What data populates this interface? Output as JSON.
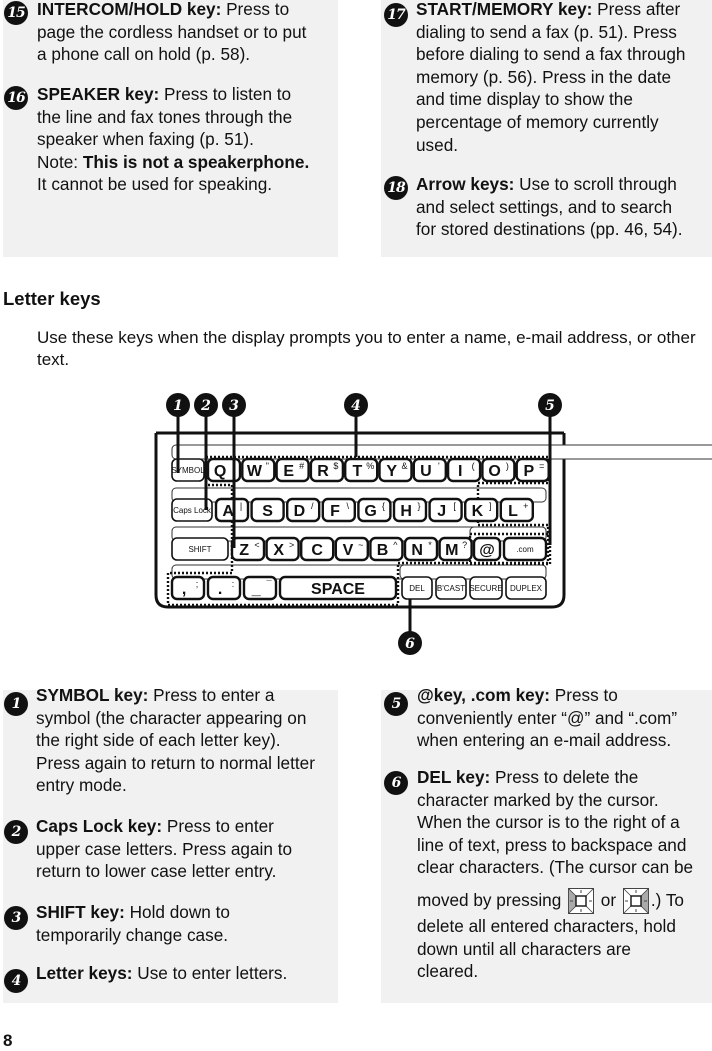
{
  "page_number": "8",
  "top_left": [
    {
      "num": "15",
      "title": "INTERCOM/HOLD key:",
      "lines": [
        " Press to",
        "page the cordless handset or to put",
        "a phone call on hold (p. 58)."
      ]
    },
    {
      "num": "16",
      "title": "SPEAKER key:",
      "lines": [
        " Press to listen to",
        "the line and fax tones through the",
        "speaker when faxing (p. 51)."
      ],
      "note_label": "Note: ",
      "note_bold": "This is not a speakerphone.",
      "note_rest": "It cannot be used for speaking."
    }
  ],
  "top_right": [
    {
      "num": "17",
      "title": "START/MEMORY key:",
      "lines": [
        " Press after",
        "dialing to send a fax (p. 51). Press",
        "before dialing to send a fax through",
        "memory (p. 56). Press in the date",
        "and time display to show the",
        "percentage of memory currently",
        "used."
      ]
    },
    {
      "num": "18",
      "title": "Arrow keys:",
      "lines": [
        " Use to scroll through",
        "and select settings, and to search",
        "for stored destinations (pp. 46, 54)."
      ]
    }
  ],
  "section": {
    "heading": "Letter keys",
    "intro": "Use these keys when the display prompts you to enter a name, e-mail address, or other text."
  },
  "keyboard": {
    "callouts": [
      "1",
      "2",
      "3",
      "4",
      "5",
      "6"
    ],
    "row1": [
      {
        "label": "SYMBOL",
        "alt": ""
      },
      {
        "label": "Q",
        "alt": "!"
      },
      {
        "label": "W",
        "alt": "\""
      },
      {
        "label": "E",
        "alt": "#"
      },
      {
        "label": "R",
        "alt": "$"
      },
      {
        "label": "T",
        "alt": "%"
      },
      {
        "label": "Y",
        "alt": "&"
      },
      {
        "label": "U",
        "alt": "'"
      },
      {
        "label": "I",
        "alt": "("
      },
      {
        "label": "O",
        "alt": ")"
      },
      {
        "label": "P",
        "alt": "="
      }
    ],
    "row2": [
      {
        "label": "Caps Lock",
        "alt": ""
      },
      {
        "label": "A",
        "alt": "|"
      },
      {
        "label": "S",
        "alt": ""
      },
      {
        "label": "D",
        "alt": "/"
      },
      {
        "label": "F",
        "alt": "\\"
      },
      {
        "label": "G",
        "alt": "{"
      },
      {
        "label": "H",
        "alt": "}"
      },
      {
        "label": "J",
        "alt": "["
      },
      {
        "label": "K",
        "alt": "]"
      },
      {
        "label": "L",
        "alt": "+"
      }
    ],
    "row3": [
      {
        "label": "SHIFT",
        "alt": ""
      },
      {
        "label": "Z",
        "alt": "<"
      },
      {
        "label": "X",
        "alt": ">"
      },
      {
        "label": "C",
        "alt": ""
      },
      {
        "label": "V",
        "alt": "~"
      },
      {
        "label": "B",
        "alt": "^"
      },
      {
        "label": "N",
        "alt": "*"
      },
      {
        "label": "M",
        "alt": "?"
      },
      {
        "label": "@",
        "alt": ""
      },
      {
        "label": ".com",
        "alt": ""
      }
    ],
    "row4": [
      {
        "label": ",",
        "alt": ";"
      },
      {
        "label": ".",
        "alt": ":"
      },
      {
        "label": "_",
        "alt": "¯"
      },
      {
        "label": "SPACE",
        "alt": ""
      },
      {
        "label": "DEL",
        "alt": ""
      },
      {
        "label": "B'CAST",
        "alt": ""
      },
      {
        "label": "SECURE",
        "alt": ""
      },
      {
        "label": "DUPLEX",
        "alt": ""
      }
    ]
  },
  "bottom_left": [
    {
      "num": "1",
      "title": "SYMBOL key:",
      "lines": [
        " Press to enter a",
        "symbol (the character appearing on",
        "the right side of each letter key).",
        "Press again to return to normal letter",
        "entry mode."
      ]
    },
    {
      "num": "2",
      "title": "Caps Lock key:",
      "lines": [
        " Press to enter",
        "upper case letters. Press again to",
        "return to lower case letter entry."
      ]
    },
    {
      "num": "3",
      "title": "SHIFT key:",
      "lines": [
        " Hold down to",
        "temporarily change case."
      ]
    },
    {
      "num": "4",
      "title": "Letter keys:",
      "lines": [
        " Use to enter letters."
      ]
    }
  ],
  "bottom_right": [
    {
      "num": "5",
      "title": "@key, .com key:",
      "lines": [
        " Press to",
        "conveniently enter “@” and “.com”",
        "when entering an e-mail address."
      ]
    },
    {
      "num": "6",
      "title": "DEL key:",
      "lines": [
        " Press to delete the",
        "character marked by the cursor.",
        "When the cursor is to the right of a",
        "line of text, press to backspace and",
        "clear characters. (The cursor can be"
      ],
      "inline_before": "moved by pressing ",
      "inline_or": " or ",
      "inline_after": ".) To",
      "tail": [
        "delete all entered characters, hold",
        "down until all characters are",
        "cleared."
      ],
      "icons": [
        "left-arrow-key-icon",
        "right-arrow-key-icon"
      ]
    }
  ]
}
